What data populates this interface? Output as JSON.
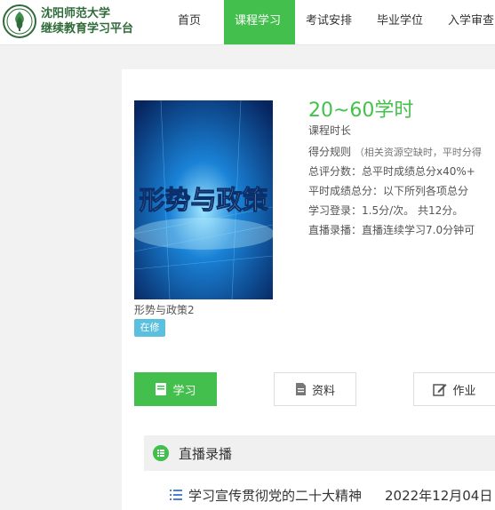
{
  "brand": {
    "line1": "沈阳师范大学",
    "line2": "继续教育学习平台"
  },
  "nav": [
    {
      "label": "首页"
    },
    {
      "label": "课程学习",
      "active": true
    },
    {
      "label": "考试安排"
    },
    {
      "label": "毕业学位"
    },
    {
      "label": "入学审查"
    }
  ],
  "course": {
    "cover_text": "形势与政策",
    "name": "形势与政策2",
    "status": "在修",
    "hours": "20~60学时",
    "hours_label": "课程时长",
    "rules": {
      "label": "得分规则",
      "note": "（相关资源空缺时，平时分得",
      "total": "总评分数：总平时成绩总分x40%+",
      "regular": "平时成绩总分：以下所列各项总分",
      "login": "学习登录：1.5分/次。 共12分。",
      "live": "直播录播：直播连续学习7.0分钟可"
    }
  },
  "buttons": {
    "study": "学习",
    "materials": "资料",
    "homework": "作业"
  },
  "section": {
    "title": "直播录播"
  },
  "lesson": {
    "title": "学习宣传贯彻党的二十大精神",
    "date": "2022年12月04日"
  },
  "colors": {
    "accent": "#43bf4d",
    "badge": "#5bc0de",
    "brand": "#2f6b3a"
  }
}
